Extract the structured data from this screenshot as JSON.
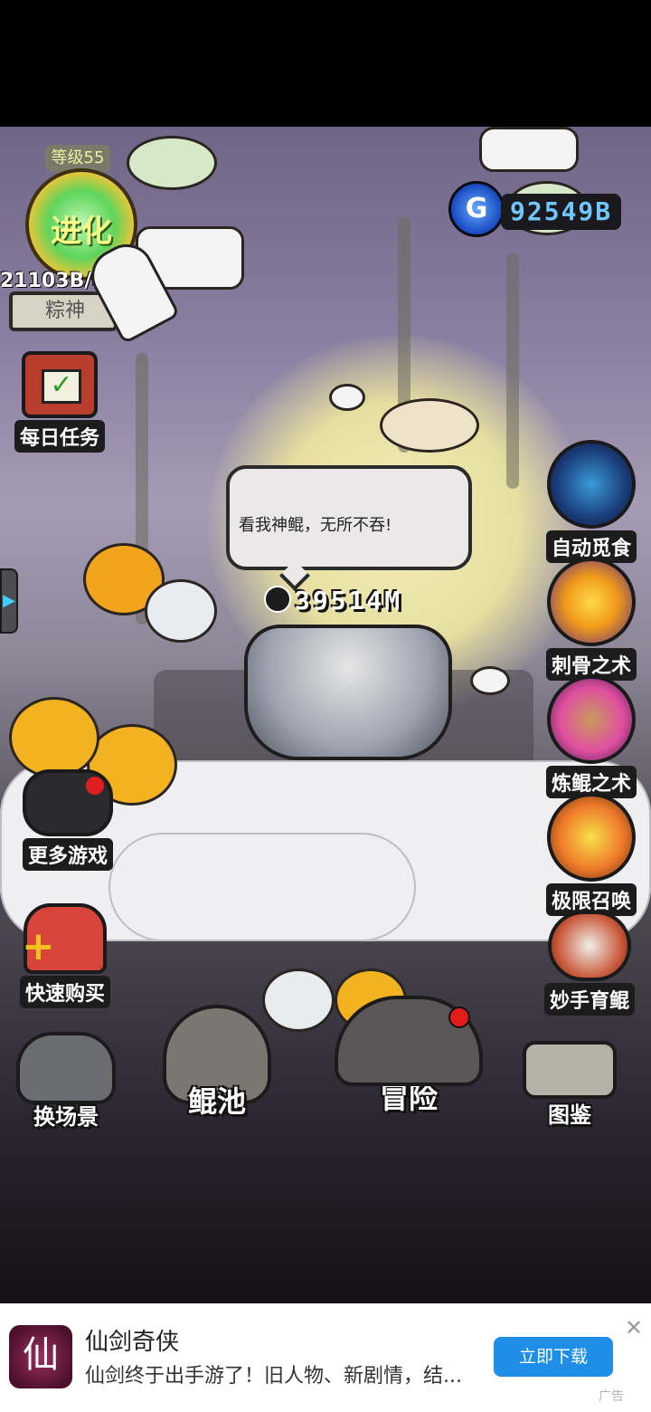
{
  "hud": {
    "level": "等级55",
    "evolve_label": "进化",
    "progress_text": "21103B/22",
    "name_plate": "粽神",
    "currency_icon": "G",
    "currency_value": "92549B"
  },
  "left_menu": {
    "daily_task": "每日任务",
    "more_games": "更多游戏",
    "quick_buy": "快速购买"
  },
  "right_menu": {
    "auto_forage": "自动觅食",
    "spine_art": "刺骨之术",
    "refine_art": "炼鲲之术",
    "ultimate_summon": "极限召唤",
    "skilled_breed": "妙手育鲲"
  },
  "character": {
    "speech": "看我神鲲，无所不吞!",
    "size": "39514M"
  },
  "bottom_nav": {
    "change_scene": "换场景",
    "kun_pool": "鲲池",
    "adventure": "冒险",
    "codex": "图鉴"
  },
  "ad": {
    "logo_glyph": "仙",
    "title": "仙剑奇侠",
    "description": "仙剑终于出手游了！旧人物、新剧情，结...",
    "button": "立即下载",
    "close": "✕",
    "tag": "广告"
  },
  "colors": {
    "accent_blue": "#1f8ee8",
    "currency_text": "#6ec8ff",
    "level_text": "#e9f39b"
  }
}
